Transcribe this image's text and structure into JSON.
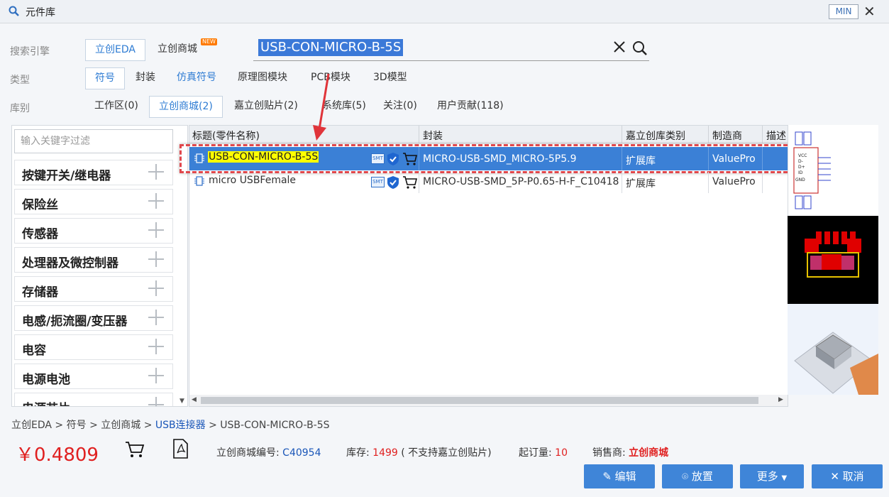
{
  "window": {
    "title": "元件库",
    "min_label": "MIN",
    "close_label": "✕"
  },
  "engine": {
    "label": "搜索引擎",
    "options": [
      "立创EDA",
      "立创商城"
    ],
    "new_badge": "NEW"
  },
  "search": {
    "value": "USB-CON-MICRO-B-5S",
    "clear_icon": "close-icon",
    "search_icon": "search-icon"
  },
  "type_row": {
    "label": "类型",
    "options": [
      "符号",
      "封装",
      "仿真符号",
      "原理图模块",
      "PCB模块",
      "3D模型"
    ]
  },
  "lib_row": {
    "label": "库别",
    "options": [
      "工作区(0)",
      "立创商城(2)",
      "嘉立创贴片(2)",
      "系统库(5)",
      "关注(0)",
      "用户贡献(118)"
    ]
  },
  "filter": {
    "placeholder": "输入关键字过滤"
  },
  "categories": [
    "按键开关/继电器",
    "保险丝",
    "传感器",
    "处理器及微控制器",
    "存储器",
    "电感/扼流圈/变压器",
    "电容",
    "电源电池",
    "电源芯片"
  ],
  "table": {
    "headers": [
      "标题(零件名称)",
      "封装",
      "嘉立创库类别",
      "制造商",
      "描述"
    ],
    "rows": [
      {
        "title": "USB-CON-MICRO-B-5S",
        "badge": "SMT",
        "package": "MICRO-USB-SMD_MICRO-5P5.9",
        "category": "扩展库",
        "manufacturer": "ValuePro"
      },
      {
        "title": "micro USBFemale",
        "badge": "SMT",
        "package": "MICRO-USB-SMD_5P-P0.65-H-F_C10418",
        "category": "扩展库",
        "manufacturer": "ValuePro"
      }
    ]
  },
  "symbol_pins": [
    "VCC",
    "D-",
    "D+",
    "ID",
    "GND"
  ],
  "footer": {
    "breadcrumb": [
      "立创EDA",
      "符号",
      "立创商城",
      "USB连接器",
      "USB-CON-MICRO-B-5S"
    ],
    "breadcrumb_sep": ">",
    "price": "￥0.4809",
    "code_label": "立创商城编号:",
    "code_value": "C40954",
    "stock_label": "库存:",
    "stock_value": "1499",
    "stock_note": "( 不支持嘉立创贴片)",
    "moq_label": "起订量:",
    "moq_value": "10",
    "seller_label": "销售商:",
    "seller_value": "立创商城"
  },
  "buttons": {
    "edit": "编辑",
    "place": "放置",
    "more": "更多",
    "cancel": "取消"
  },
  "colors": {
    "accent": "#3f85d8",
    "price": "#e02020",
    "selected_row": "#3b80d6",
    "highlight": "#ffff00"
  }
}
